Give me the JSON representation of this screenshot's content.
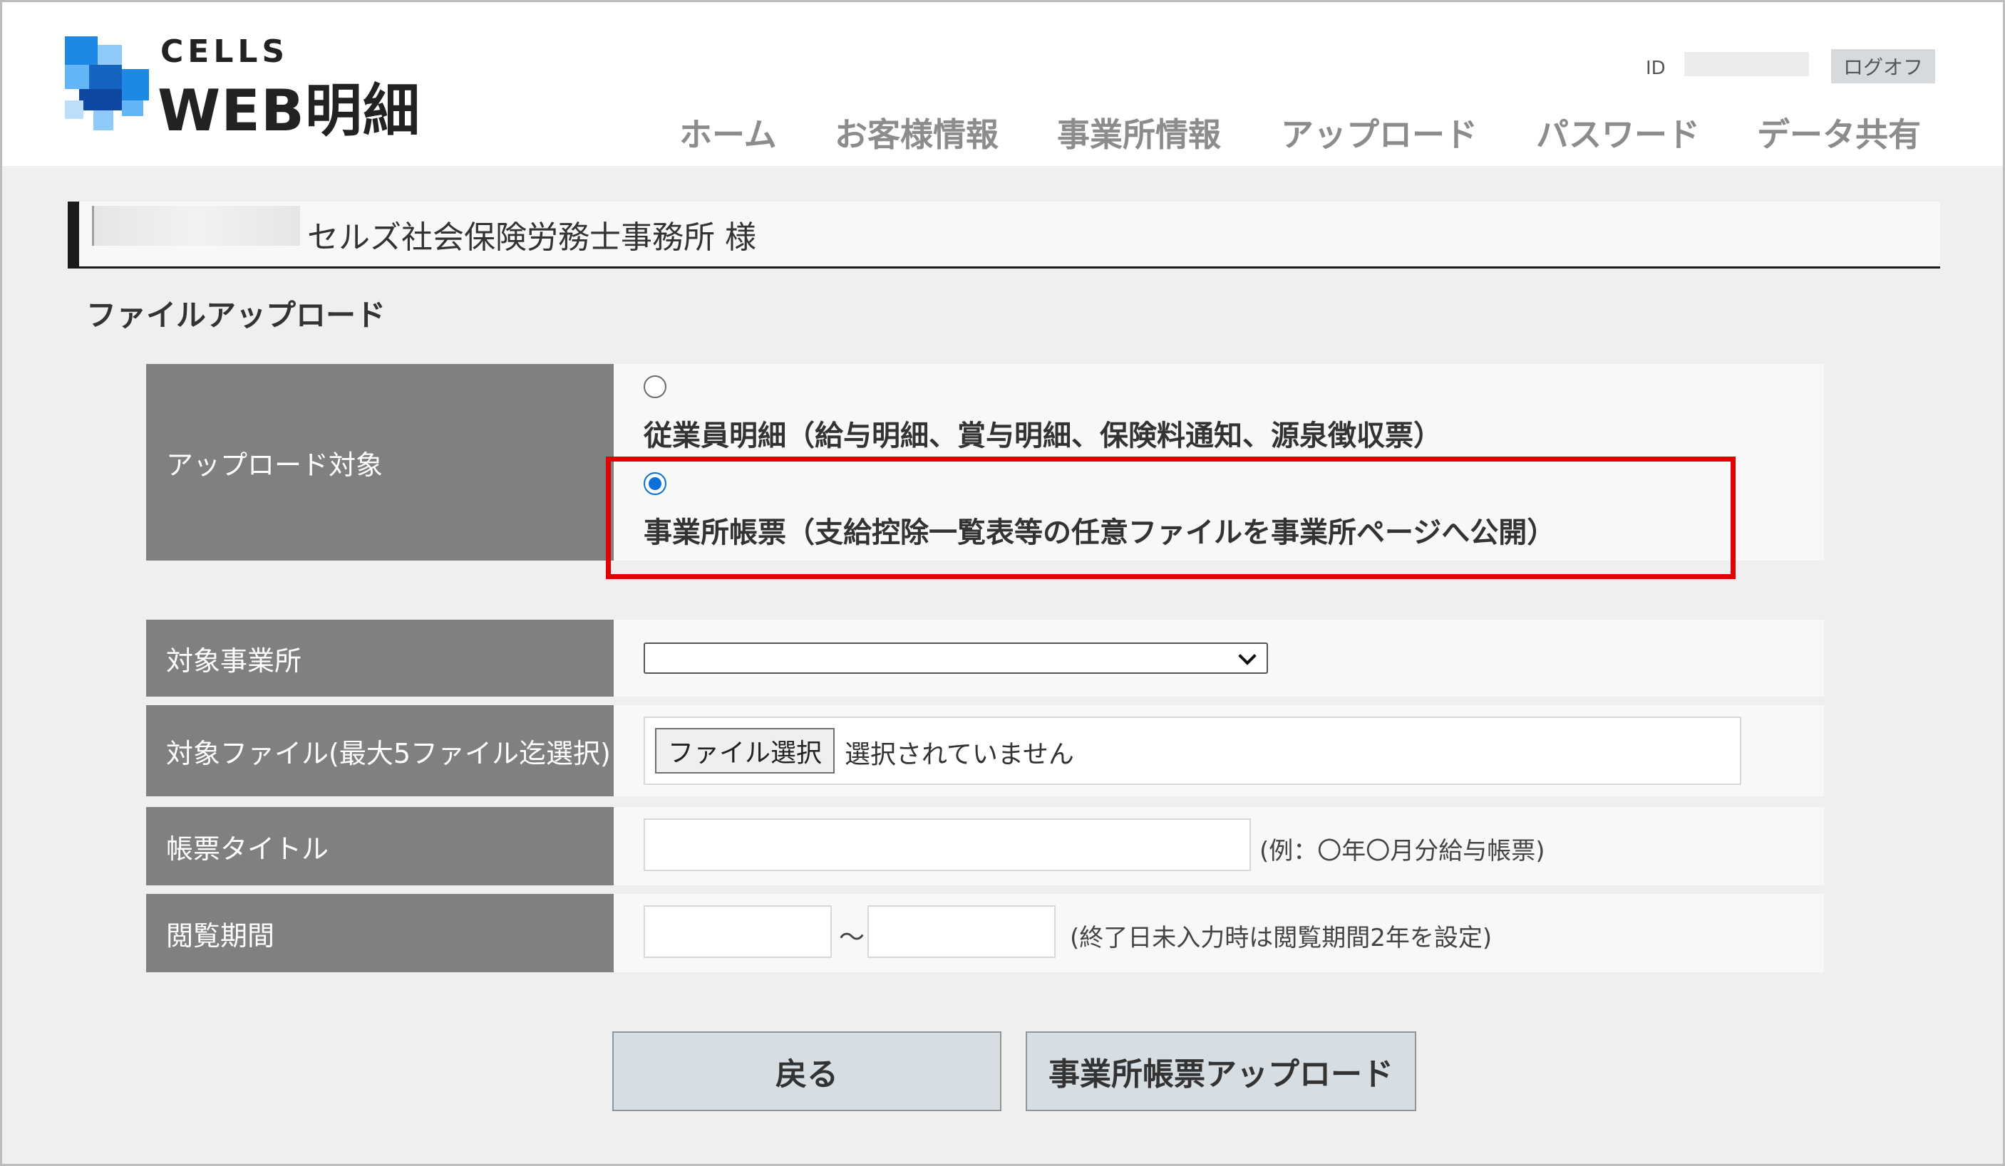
{
  "header": {
    "logo": {
      "brand_top": "CELLS",
      "brand_main": "WEB明細"
    },
    "id_label": "ID",
    "logoff_label": "ログオフ",
    "nav": [
      {
        "label": "ホーム"
      },
      {
        "label": "お客様情報"
      },
      {
        "label": "事業所情報"
      },
      {
        "label": "アップロード"
      },
      {
        "label": "パスワード"
      },
      {
        "label": "データ共有"
      }
    ]
  },
  "customer": {
    "name_suffix": "セルズ社会保険労務士事務所 様"
  },
  "section_title": "ファイルアップロード",
  "form": {
    "upload_target": {
      "label": "アップロード対象",
      "options": [
        {
          "label": "従業員明細（給与明細、賞与明細、保険料通知、源泉徴収票）",
          "checked": false
        },
        {
          "label": "事業所帳票（支給控除一覧表等の任意ファイルを事業所ページへ公開）",
          "checked": true
        }
      ]
    },
    "office": {
      "label": "対象事業所",
      "selected": ""
    },
    "files": {
      "label": "対象ファイル(最大5ファイル迄選択)",
      "button_label": "ファイル選択",
      "status": "選択されていません"
    },
    "title": {
      "label": "帳票タイトル",
      "value": "",
      "hint": "(例：〇年〇月分給与帳票)"
    },
    "period": {
      "label": "閲覧期間",
      "from": "",
      "separator": "～",
      "to": "",
      "hint": "(終了日未入力時は閲覧期間2年を設定)"
    }
  },
  "buttons": {
    "back_label": "戻る",
    "upload_label": "事業所帳票アップロード"
  },
  "colors": {
    "highlight": "#e00000",
    "label_bg": "#808080",
    "radio_checked": "#0b6fd6"
  },
  "icons": {
    "logo": "cells-logo-icon",
    "dropdown": "chevron-down-icon"
  }
}
